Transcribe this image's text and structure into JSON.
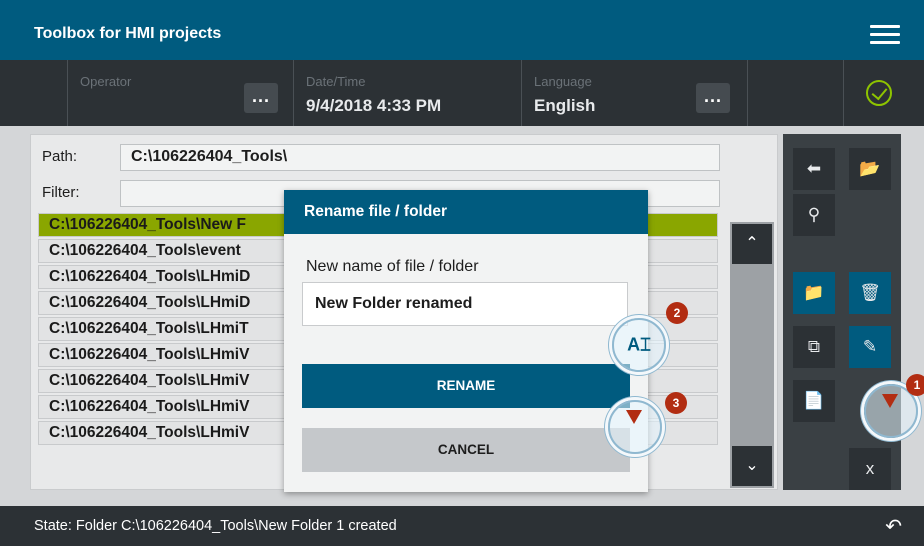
{
  "app": {
    "title": "Toolbox for HMI projects"
  },
  "status_bar": {
    "operator_label": "Operator",
    "operator_button": "...",
    "datetime_label": "Date/Time",
    "datetime_value": "9/4/2018 4:33 PM",
    "language_label": "Language",
    "language_value": "English",
    "language_button": "..."
  },
  "browser": {
    "path_label": "Path:",
    "path_value": "C:\\106226404_Tools\\",
    "filter_label": "Filter:",
    "filter_value": "",
    "items": [
      "C:\\106226404_Tools\\New F",
      "C:\\106226404_Tools\\event",
      "C:\\106226404_Tools\\LHmiD",
      "C:\\106226404_Tools\\LHmiD",
      "C:\\106226404_Tools\\LHmiT",
      "C:\\106226404_Tools\\LHmiV",
      "C:\\106226404_Tools\\LHmiV",
      "C:\\106226404_Tools\\LHmiV",
      "C:\\106226404_Tools\\LHmiV"
    ],
    "selected_index": 0
  },
  "dialog": {
    "title": "Rename file / folder",
    "label": "New name of file / folder",
    "input_value": "New Folder renamed",
    "rename_label": "RENAME",
    "cancel_label": "CANCEL"
  },
  "hints": {
    "step2": "2",
    "step3": "3",
    "step1": "1"
  },
  "footer": {
    "state": "State: Folder C:\\106226404_Tools\\New Folder 1 created"
  },
  "colors": {
    "brand": "#005b7f",
    "selection": "#8aa600",
    "dark": "#2c3135",
    "ok": "#8ec400",
    "hint": "#b22d12"
  },
  "icons": [
    "menu-icon",
    "check-circle-icon",
    "arrow-left-icon",
    "folder-download-icon",
    "search-icon",
    "new-folder-icon",
    "trash-icon",
    "copy-icon",
    "pencil-icon",
    "file-icon",
    "close-icon",
    "back-icon",
    "chevron-up-icon",
    "chevron-down-icon"
  ]
}
